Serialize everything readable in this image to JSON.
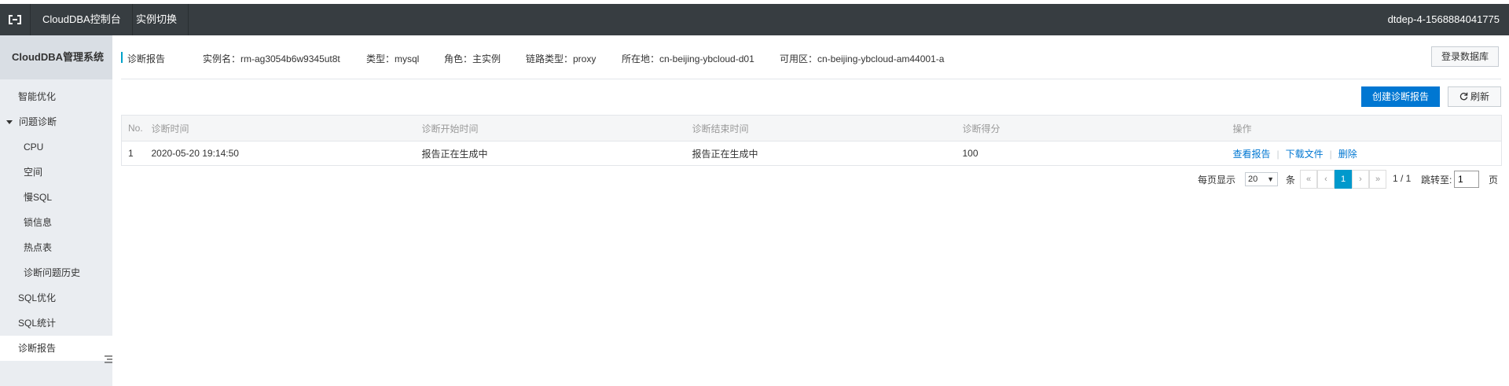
{
  "topbar": {
    "console_label": "CloudDBA控制台",
    "switch_label": "实例切换",
    "user": "dtdep-4-1568884041775"
  },
  "sidebar": {
    "title": "CloudDBA管理系统",
    "items": [
      {
        "label": "智能优化"
      },
      {
        "label": "问题诊断"
      },
      {
        "label": "CPU"
      },
      {
        "label": "空间"
      },
      {
        "label": "慢SQL"
      },
      {
        "label": "锁信息"
      },
      {
        "label": "热点表"
      },
      {
        "label": "诊断问题历史"
      },
      {
        "label": "SQL优化"
      },
      {
        "label": "SQL统计"
      },
      {
        "label": "诊断报告"
      }
    ]
  },
  "infobar": {
    "page_title": "诊断报告",
    "instance": "实例名：rm-ag3054b6w9345ut8t",
    "type": "类型：mysql",
    "role": "角色：主实例",
    "link_type": "链路类型：proxy",
    "location": "所在地：cn-beijing-ybcloud-d01",
    "zone": "可用区：cn-beijing-ybcloud-am44001-a",
    "login_button": "登录数据库"
  },
  "toolbar": {
    "create_button": "创建诊断报告",
    "refresh_button": "刷新"
  },
  "table": {
    "headers": [
      "No.",
      "诊断时间",
      "诊断开始时间",
      "诊断结束时间",
      "诊断得分",
      "操作"
    ],
    "rows": [
      {
        "no": "1",
        "time": "2020-05-20 19:14:50",
        "start": "报告正在生成中",
        "end": "报告正在生成中",
        "score": "100",
        "actions": [
          "查看报告",
          "下载文件",
          "删除"
        ]
      }
    ]
  },
  "pagination": {
    "per_page_label": "每页显示",
    "per_page_value": "20",
    "unit": "条",
    "first": "«",
    "prev": "‹",
    "current": "1",
    "next": "›",
    "last": "»",
    "total": "1 / 1",
    "jump_label": "跳转至:",
    "jump_value": "1",
    "page_unit": "页"
  },
  "colors": {
    "topbar": "#373d41",
    "sidebar": "#eaedf1",
    "primary": "#0077d2",
    "accent": "#00a2ca"
  }
}
